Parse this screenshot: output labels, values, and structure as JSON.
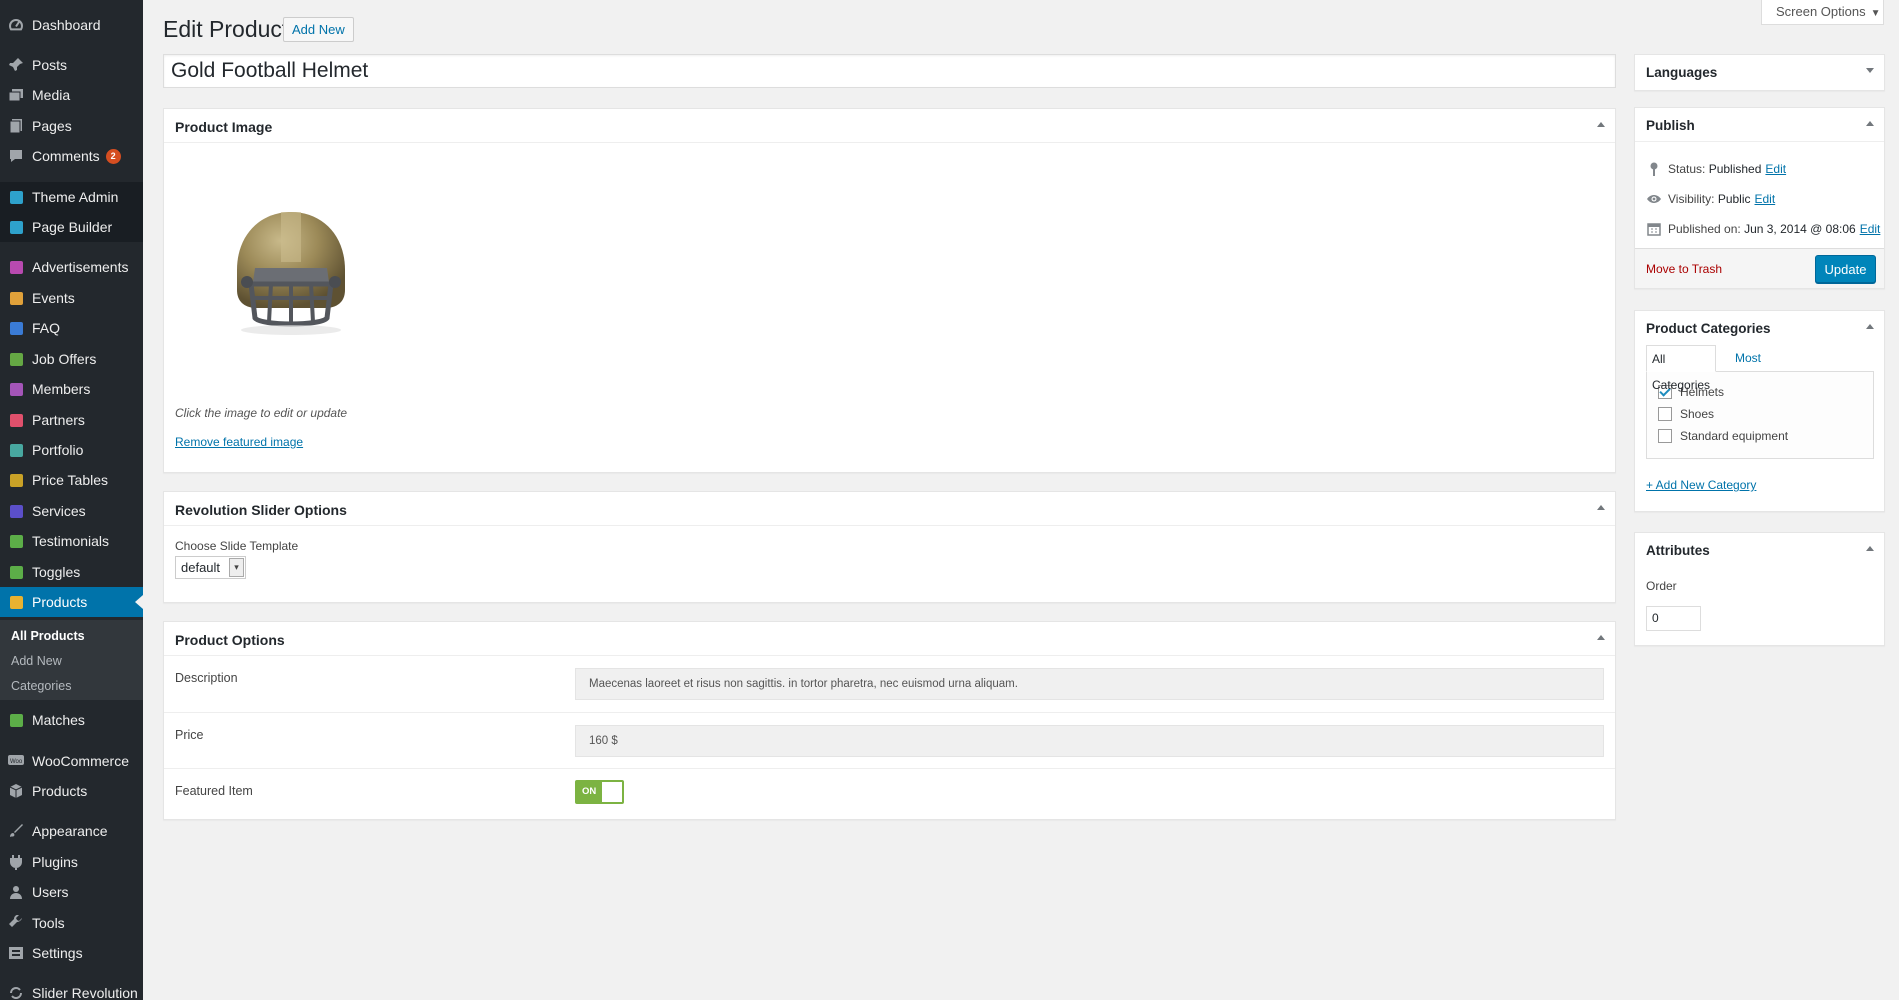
{
  "colors": {
    "sidebar_bg": "#23282d",
    "active_menu": "#0073aa",
    "accent_link": "#0073aa",
    "update_btn": "#0085ba",
    "toggle_on": "#7cb342",
    "trash_red": "#a00",
    "badge": "#d54e21"
  },
  "sidebar": {
    "items": [
      {
        "label": "Dashboard",
        "icon": "dashboard-icon"
      },
      {
        "label": "Posts",
        "icon": "pin-icon"
      },
      {
        "label": "Media",
        "icon": "media-icon"
      },
      {
        "label": "Pages",
        "icon": "pages-icon"
      },
      {
        "label": "Comments",
        "icon": "comments-icon",
        "badge": "2"
      },
      {
        "label": "Theme Admin",
        "icon": "theme-admin-icon"
      },
      {
        "label": "Page Builder",
        "icon": "page-builder-icon"
      },
      {
        "label": "Advertisements",
        "icon": "advertisements-icon"
      },
      {
        "label": "Events",
        "icon": "events-icon"
      },
      {
        "label": "FAQ",
        "icon": "faq-icon"
      },
      {
        "label": "Job Offers",
        "icon": "job-offers-icon"
      },
      {
        "label": "Members",
        "icon": "members-icon"
      },
      {
        "label": "Partners",
        "icon": "partners-icon"
      },
      {
        "label": "Portfolio",
        "icon": "portfolio-icon"
      },
      {
        "label": "Price Tables",
        "icon": "price-tables-icon"
      },
      {
        "label": "Services",
        "icon": "services-icon"
      },
      {
        "label": "Testimonials",
        "icon": "testimonials-icon"
      },
      {
        "label": "Toggles",
        "icon": "toggles-icon"
      },
      {
        "label": "Products",
        "icon": "products-icon"
      },
      {
        "label": "Matches",
        "icon": "matches-icon"
      },
      {
        "label": "WooCommerce",
        "icon": "woocommerce-icon"
      },
      {
        "label": "Products",
        "icon": "products-box-icon"
      },
      {
        "label": "Appearance",
        "icon": "appearance-icon"
      },
      {
        "label": "Plugins",
        "icon": "plugins-icon"
      },
      {
        "label": "Users",
        "icon": "users-icon"
      },
      {
        "label": "Tools",
        "icon": "tools-icon"
      },
      {
        "label": "Settings",
        "icon": "settings-icon"
      },
      {
        "label": "Slider Revolution",
        "icon": "slider-revolution-icon"
      }
    ],
    "submenu": [
      "All Products",
      "Add New",
      "Categories"
    ]
  },
  "header": {
    "title": "Edit Product",
    "add_new": "Add New",
    "screen_options": "Screen Options"
  },
  "post_title": "Gold Football Helmet",
  "product_image": {
    "title": "Product Image",
    "note": "Click the image to edit or update",
    "remove_link": "Remove featured image"
  },
  "revolution": {
    "title": "Revolution Slider Options",
    "label": "Choose Slide Template",
    "selected": "default"
  },
  "product_options": {
    "title": "Product Options",
    "rows": [
      {
        "label": "Description",
        "value": "Maecenas laoreet et risus non sagittis. in tortor pharetra, nec euismod urna aliquam."
      },
      {
        "label": "Price",
        "value": "160 $"
      },
      {
        "label": "Featured Item",
        "toggle": "ON"
      }
    ]
  },
  "languages": {
    "title": "Languages"
  },
  "publish": {
    "title": "Publish",
    "status_label": "Status:",
    "status_value": "Published",
    "visibility_label": "Visibility:",
    "visibility_value": "Public",
    "published_label": "Published on:",
    "published_value": "Jun 3, 2014 @ 08:06",
    "edit": "Edit",
    "trash": "Move to Trash",
    "update": "Update"
  },
  "categories": {
    "title": "Product Categories",
    "tab_all": "All Categories",
    "tab_most": "Most Used",
    "items": [
      {
        "label": "Helmets",
        "checked": true
      },
      {
        "label": "Shoes",
        "checked": false
      },
      {
        "label": "Standard equipment",
        "checked": false
      }
    ],
    "add_new": "+ Add New Category"
  },
  "attributes": {
    "title": "Attributes",
    "order_label": "Order",
    "order_value": "0"
  }
}
